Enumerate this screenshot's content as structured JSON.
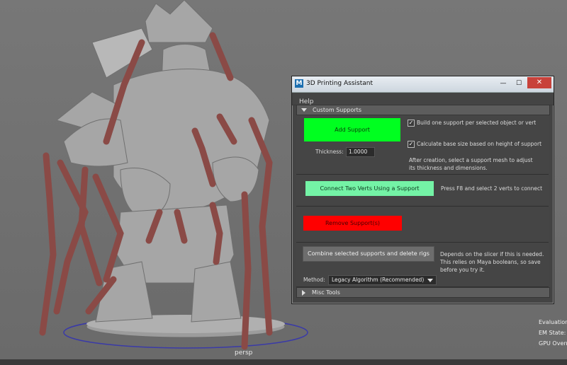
{
  "viewport": {
    "camera_label": "persp",
    "hud": [
      "Evaluation",
      "EM State:",
      "GPU Overr"
    ]
  },
  "window": {
    "title": "3D Printing Assistant",
    "app_icon": "M",
    "minimize_glyph": "—",
    "maximize_glyph": "☐",
    "close_glyph": "✕",
    "menu": {
      "help": "Help"
    }
  },
  "custom_supports": {
    "header": "Custom Supports",
    "add_support": {
      "button": "Add Support",
      "thickness_label": "Thickness:",
      "thickness_value": "1.0000",
      "opt_one_per_object": "Build one support per selected object or vert",
      "opt_one_per_object_checked": true,
      "opt_calc_base": "Calculate base size based on height of support",
      "opt_calc_base_checked": true,
      "after_creation_line1": "After creation, select a support mesh to adjust",
      "after_creation_line2": "its thickness and dimensions."
    },
    "connect": {
      "button": "Connect Two Verts Using a Support",
      "hint": "Press F8 and select 2 verts to connect"
    },
    "remove": {
      "button": "Remove Support(s)"
    },
    "combine": {
      "button": "Combine selected supports and delete rigs",
      "note_line1": "Depends on the slicer if this is needed.",
      "note_line2": "This relies on Maya booleans, so save",
      "note_line3": "before you try it.",
      "method_label": "Method:",
      "method_value": "Legacy Algorithm (Recommended)"
    }
  },
  "misc_tools": {
    "header": "Misc Tools"
  },
  "colors": {
    "add_support": "#00ff20",
    "connect": "#74f3a6",
    "remove": "#ff0000",
    "support_mesh": "#8a4a46",
    "model": "#9a9a9a"
  }
}
